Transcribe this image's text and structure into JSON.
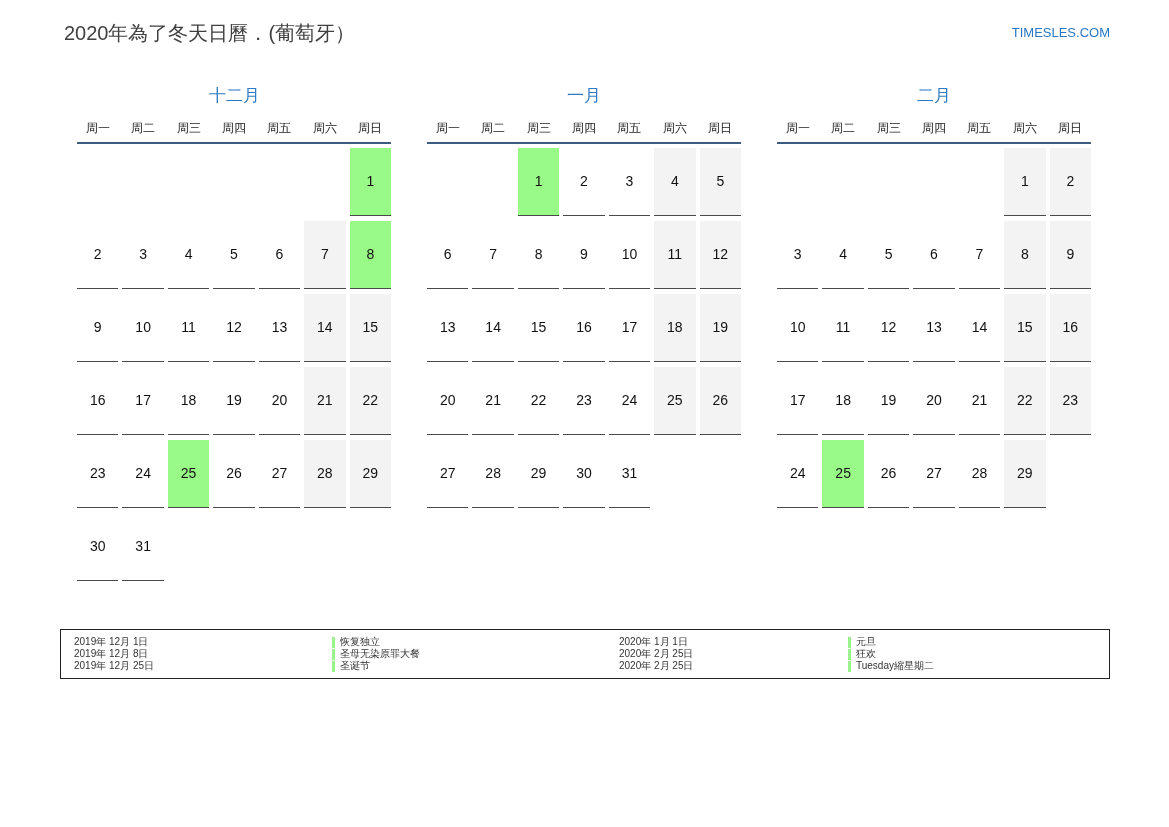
{
  "header": {
    "title": "2020年為了冬天日曆．(葡萄牙）",
    "logo": "TIMESLES.COM"
  },
  "months": [
    {
      "title": "十二月",
      "weekdays": [
        "周一",
        "周二",
        "周三",
        "周四",
        "周五",
        "周六",
        "周日"
      ],
      "days": [
        {
          "kind": "blank"
        },
        {
          "kind": "blank"
        },
        {
          "kind": "blank"
        },
        {
          "kind": "blank"
        },
        {
          "kind": "blank"
        },
        {
          "kind": "blank"
        },
        {
          "day": "1",
          "kind": "holiday"
        },
        {
          "day": "2",
          "kind": "weekday"
        },
        {
          "day": "3",
          "kind": "weekday"
        },
        {
          "day": "4",
          "kind": "weekday"
        },
        {
          "day": "5",
          "kind": "weekday"
        },
        {
          "day": "6",
          "kind": "weekday"
        },
        {
          "day": "7",
          "kind": "weekend"
        },
        {
          "day": "8",
          "kind": "holiday"
        },
        {
          "day": "9",
          "kind": "weekday"
        },
        {
          "day": "10",
          "kind": "weekday"
        },
        {
          "day": "11",
          "kind": "weekday"
        },
        {
          "day": "12",
          "kind": "weekday"
        },
        {
          "day": "13",
          "kind": "weekday"
        },
        {
          "day": "14",
          "kind": "weekend"
        },
        {
          "day": "15",
          "kind": "weekend"
        },
        {
          "day": "16",
          "kind": "weekday"
        },
        {
          "day": "17",
          "kind": "weekday"
        },
        {
          "day": "18",
          "kind": "weekday"
        },
        {
          "day": "19",
          "kind": "weekday"
        },
        {
          "day": "20",
          "kind": "weekday"
        },
        {
          "day": "21",
          "kind": "weekend"
        },
        {
          "day": "22",
          "kind": "weekend"
        },
        {
          "day": "23",
          "kind": "weekday"
        },
        {
          "day": "24",
          "kind": "weekday"
        },
        {
          "day": "25",
          "kind": "holiday"
        },
        {
          "day": "26",
          "kind": "weekday"
        },
        {
          "day": "27",
          "kind": "weekday"
        },
        {
          "day": "28",
          "kind": "weekend"
        },
        {
          "day": "29",
          "kind": "weekend"
        },
        {
          "day": "30",
          "kind": "weekday"
        },
        {
          "day": "31",
          "kind": "weekday"
        }
      ]
    },
    {
      "title": "一月",
      "weekdays": [
        "周一",
        "周二",
        "周三",
        "周四",
        "周五",
        "周六",
        "周日"
      ],
      "days": [
        {
          "kind": "blank"
        },
        {
          "kind": "blank"
        },
        {
          "day": "1",
          "kind": "holiday"
        },
        {
          "day": "2",
          "kind": "weekday"
        },
        {
          "day": "3",
          "kind": "weekday"
        },
        {
          "day": "4",
          "kind": "weekend"
        },
        {
          "day": "5",
          "kind": "weekend"
        },
        {
          "day": "6",
          "kind": "weekday"
        },
        {
          "day": "7",
          "kind": "weekday"
        },
        {
          "day": "8",
          "kind": "weekday"
        },
        {
          "day": "9",
          "kind": "weekday"
        },
        {
          "day": "10",
          "kind": "weekday"
        },
        {
          "day": "11",
          "kind": "weekend"
        },
        {
          "day": "12",
          "kind": "weekend"
        },
        {
          "day": "13",
          "kind": "weekday"
        },
        {
          "day": "14",
          "kind": "weekday"
        },
        {
          "day": "15",
          "kind": "weekday"
        },
        {
          "day": "16",
          "kind": "weekday"
        },
        {
          "day": "17",
          "kind": "weekday"
        },
        {
          "day": "18",
          "kind": "weekend"
        },
        {
          "day": "19",
          "kind": "weekend"
        },
        {
          "day": "20",
          "kind": "weekday"
        },
        {
          "day": "21",
          "kind": "weekday"
        },
        {
          "day": "22",
          "kind": "weekday"
        },
        {
          "day": "23",
          "kind": "weekday"
        },
        {
          "day": "24",
          "kind": "weekday"
        },
        {
          "day": "25",
          "kind": "weekend"
        },
        {
          "day": "26",
          "kind": "weekend"
        },
        {
          "day": "27",
          "kind": "weekday"
        },
        {
          "day": "28",
          "kind": "weekday"
        },
        {
          "day": "29",
          "kind": "weekday"
        },
        {
          "day": "30",
          "kind": "weekday"
        },
        {
          "day": "31",
          "kind": "weekday"
        }
      ]
    },
    {
      "title": "二月",
      "weekdays": [
        "周一",
        "周二",
        "周三",
        "周四",
        "周五",
        "周六",
        "周日"
      ],
      "days": [
        {
          "kind": "blank"
        },
        {
          "kind": "blank"
        },
        {
          "kind": "blank"
        },
        {
          "kind": "blank"
        },
        {
          "kind": "blank"
        },
        {
          "day": "1",
          "kind": "weekend"
        },
        {
          "day": "2",
          "kind": "weekend"
        },
        {
          "day": "3",
          "kind": "weekday"
        },
        {
          "day": "4",
          "kind": "weekday"
        },
        {
          "day": "5",
          "kind": "weekday"
        },
        {
          "day": "6",
          "kind": "weekday"
        },
        {
          "day": "7",
          "kind": "weekday"
        },
        {
          "day": "8",
          "kind": "weekend"
        },
        {
          "day": "9",
          "kind": "weekend"
        },
        {
          "day": "10",
          "kind": "weekday"
        },
        {
          "day": "11",
          "kind": "weekday"
        },
        {
          "day": "12",
          "kind": "weekday"
        },
        {
          "day": "13",
          "kind": "weekday"
        },
        {
          "day": "14",
          "kind": "weekday"
        },
        {
          "day": "15",
          "kind": "weekend"
        },
        {
          "day": "16",
          "kind": "weekend"
        },
        {
          "day": "17",
          "kind": "weekday"
        },
        {
          "day": "18",
          "kind": "weekday"
        },
        {
          "day": "19",
          "kind": "weekday"
        },
        {
          "day": "20",
          "kind": "weekday"
        },
        {
          "day": "21",
          "kind": "weekday"
        },
        {
          "day": "22",
          "kind": "weekend"
        },
        {
          "day": "23",
          "kind": "weekend"
        },
        {
          "day": "24",
          "kind": "weekday"
        },
        {
          "day": "25",
          "kind": "holiday"
        },
        {
          "day": "26",
          "kind": "weekday"
        },
        {
          "day": "27",
          "kind": "weekday"
        },
        {
          "day": "28",
          "kind": "weekday"
        },
        {
          "day": "29",
          "kind": "weekend"
        }
      ]
    }
  ],
  "legend": {
    "columns": [
      {
        "entries": [
          {
            "date": "2019年 12月 1日",
            "name": "恢复独立"
          },
          {
            "date": "2019年 12月 8日",
            "name": "圣母无染原罪大餐"
          },
          {
            "date": "2019年 12月 25日",
            "name": "圣诞节"
          }
        ]
      },
      {
        "entries": [
          {
            "date": "2020年 1月 1日",
            "name": "元旦"
          },
          {
            "date": "2020年 2月 25日",
            "name": "狂欢"
          },
          {
            "date": "2020年 2月 25日",
            "name": "Tuesday縮星期二"
          }
        ]
      }
    ]
  }
}
